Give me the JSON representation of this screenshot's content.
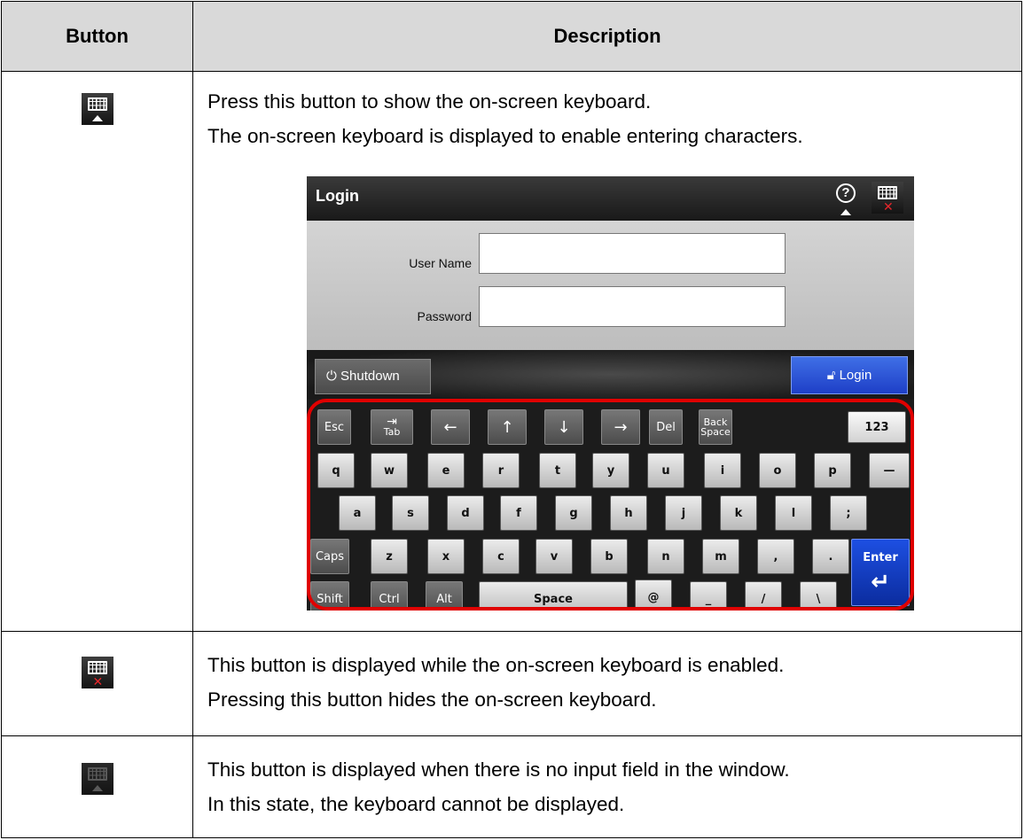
{
  "table": {
    "header_button": "Button",
    "header_description": "Description"
  },
  "rows": [
    {
      "icon": "keyboard-show-icon",
      "lines": [
        "Press this button to show the on-screen keyboard.",
        "The on-screen keyboard is displayed to enable entering characters."
      ]
    },
    {
      "icon": "keyboard-hide-icon",
      "lines": [
        "This button is displayed while the on-screen keyboard is enabled.",
        "Pressing this button hides the on-screen keyboard."
      ]
    },
    {
      "icon": "keyboard-disabled-icon",
      "lines": [
        "This button is displayed when there is no input field in the window.",
        "In this state, the keyboard cannot be displayed."
      ]
    }
  ],
  "screen": {
    "title": "Login",
    "help_icon": "help-icon",
    "username_label": "User Name",
    "password_label": "Password",
    "shutdown_label": "Shutdown",
    "login_label": "Login",
    "colors": {
      "ring": "#e00000",
      "login_button": "#1e3fc7",
      "enter_key": "#0b2c9e"
    }
  },
  "keyboard": {
    "row1": [
      "Esc",
      "Tab",
      "←",
      "↑",
      "↓",
      "→",
      "Del",
      "Back Space",
      "123"
    ],
    "row2": [
      "q",
      "w",
      "e",
      "r",
      "t",
      "y",
      "u",
      "i",
      "o",
      "p",
      "—"
    ],
    "row3": [
      "a",
      "s",
      "d",
      "f",
      "g",
      "h",
      "j",
      "k",
      "l",
      ";"
    ],
    "row4": [
      "Caps",
      "z",
      "x",
      "c",
      "v",
      "b",
      "n",
      "m",
      ",",
      ".",
      "Enter"
    ],
    "row5": [
      "Shift",
      "Ctrl",
      "Alt",
      "Space",
      "@",
      "_",
      "/",
      "\\"
    ]
  }
}
